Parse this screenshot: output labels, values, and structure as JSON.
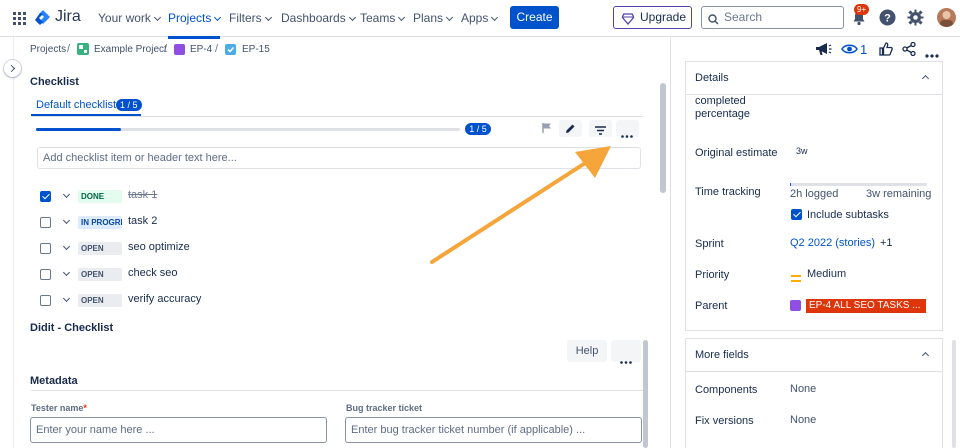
{
  "topnav": {
    "logo": "Jira",
    "items": [
      "Your work",
      "Projects",
      "Filters",
      "Dashboards",
      "Teams",
      "Plans",
      "Apps"
    ],
    "create": "Create",
    "upgrade": "Upgrade",
    "search_placeholder": "Search",
    "notif_count": "9+"
  },
  "breadcrumbs": [
    "Projects",
    "Example Project",
    "EP-4",
    "EP-15"
  ],
  "checklist": {
    "title": "Checklist",
    "tab_label": "Default checklist",
    "tab_count": "1 / 5",
    "progress_text": "1 / 5",
    "progress_fraction": 0.2,
    "add_placeholder": "Add checklist item or header text here...",
    "items": [
      {
        "status": "DONE",
        "label": "task 1",
        "checked": true
      },
      {
        "status": "IN PROGRESS",
        "label": "task 2",
        "checked": false
      },
      {
        "status": "OPEN",
        "label": "seo optimize",
        "checked": false
      },
      {
        "status": "OPEN",
        "label": "check seo",
        "checked": false
      },
      {
        "status": "OPEN",
        "label": "verify accuracy",
        "checked": false
      }
    ]
  },
  "didit": {
    "title": "Didit - Checklist",
    "help": "Help"
  },
  "metadata": {
    "title": "Metadata",
    "tester_label": "Tester name",
    "tester_required": "*",
    "tester_placeholder": "Enter your name here ...",
    "bug_label": "Bug tracker ticket",
    "bug_placeholder": "Enter bug tracker ticket number (if applicable) ..."
  },
  "watch_count": "1",
  "details": {
    "title": "Details",
    "completed_label": "completed",
    "percentage_label": "percentage",
    "original_estimate_label": "Original estimate",
    "original_estimate_value": "3w",
    "time_tracking_label": "Time tracking",
    "logged": "2h logged",
    "remaining": "3w remaining",
    "time_fraction": 0.01,
    "include_subtasks": "Include subtasks",
    "sprint_label": "Sprint",
    "sprint_value": "Q2 2022 (stories)",
    "sprint_more": "+1",
    "priority_label": "Priority",
    "priority_value": "Medium",
    "parent_label": "Parent",
    "parent_value": "EP-4 ALL SEO TASKS ..."
  },
  "more_fields": {
    "title": "More fields",
    "components_label": "Components",
    "components_value": "None",
    "fix_versions_label": "Fix versions",
    "fix_versions_value": "None"
  },
  "colors": {
    "accent": "#0052cc",
    "arrow": "#f6a53a",
    "parent_chip": "#de350b",
    "priority_medium": "#ffab00"
  }
}
